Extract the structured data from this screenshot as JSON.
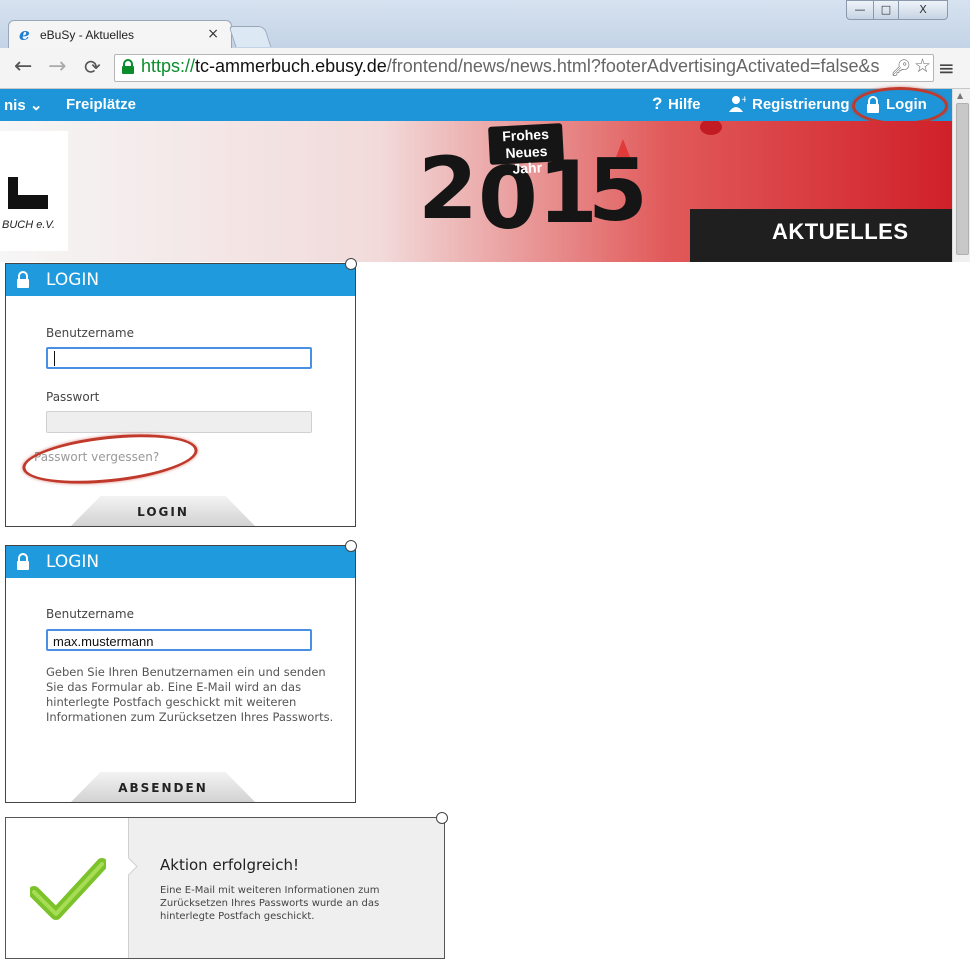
{
  "browser": {
    "tab_title": "eBuSy - Aktuelles",
    "tab_close": "×",
    "url_scheme": "https://",
    "url_host": "tc-ammerbuch.ebusy.de",
    "url_path": "/frontend/news/news.html?footerAdvertisingActivated=false&s",
    "window_min": "—",
    "window_max": "□",
    "window_close": "X"
  },
  "site_nav": {
    "item_partial": "nis",
    "item_freiplaetze": "Freiplätze",
    "hilfe": "Hilfe",
    "registrierung": "Registrierung",
    "login": "Login"
  },
  "banner": {
    "logo_text": "BUCH e.V.",
    "greeting_line1": "Frohes",
    "greeting_line2": "Neues Jahr",
    "year_digits": [
      "2",
      "0",
      "1",
      "5"
    ],
    "section_title": "AKTUELLES"
  },
  "login_form_1": {
    "title": "LOGIN",
    "username_label": "Benutzername",
    "username_value": "",
    "password_label": "Passwort",
    "forgot_link": "Passwort vergessen?",
    "submit_label": "LOGIN"
  },
  "login_form_2": {
    "title": "LOGIN",
    "username_label": "Benutzername",
    "username_value": "max.mustermann",
    "help_text": "Geben Sie Ihren Benutzernamen ein und senden Sie das Formular ab. Eine E-Mail wird an das hinterlegte Postfach geschickt mit weiteren Informationen zum Zurücksetzen Ihres Passworts.",
    "submit_label": "ABSENDEN"
  },
  "success_dialog": {
    "title": "Aktion erfolgreich!",
    "message": "Eine E-Mail mit weiteren Informationen zum Zurücksetzen Ihres Passworts wurde an das hinterlegte Postfach geschickt."
  },
  "colors": {
    "nav_blue": "#1e95d8",
    "panel_header_blue": "#1f9bdd",
    "highlight_ring": "#c0392b",
    "check_green": "#7cc22b"
  }
}
